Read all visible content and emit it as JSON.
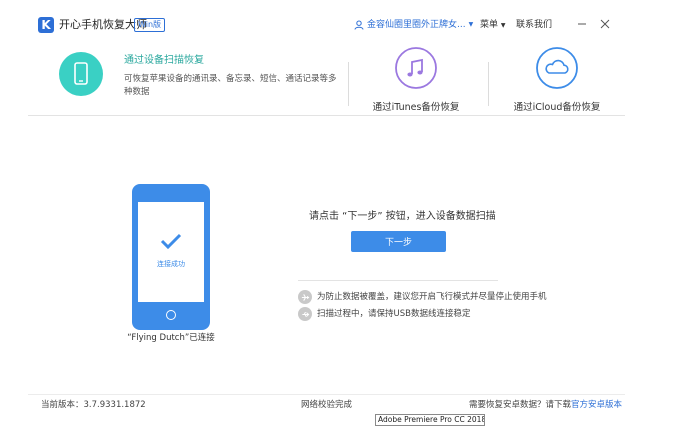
{
  "titlebar": {
    "logo_letter": "K",
    "app_title": "开心手机恢复大师",
    "edition_badge": "Win版",
    "user_name": "金容仙圈里圈外正牌女...",
    "menu_label": "菜单",
    "contact_label": "联系我们"
  },
  "modes": {
    "device": {
      "title": "通过设备扫描恢复",
      "description": "可恢复苹果设备的通讯录、备忘录、短信、通话记录等多种数据"
    },
    "itunes": {
      "label": "通过iTunes备份恢复"
    },
    "icloud": {
      "label": "通过iCloud备份恢复"
    }
  },
  "device": {
    "status": "连接成功",
    "connected_text": "“Flying Dutch”已连接"
  },
  "scan": {
    "instruction": "请点击 “下一步” 按钮，进入设备数据扫描",
    "next_button": "下一步"
  },
  "tips": [
    {
      "icon": "airplane-icon",
      "text": "为防止数据被覆盖，建议您开启飞行模式并尽量停止使用手机"
    },
    {
      "icon": "usb-icon",
      "text": "扫描过程中，请保持USB数据线连接稳定"
    }
  ],
  "footer": {
    "version": "当前版本：3.7.9331.1872",
    "network_status": "网络校验完成",
    "android_prompt": "需要恢复安卓数据？请下载",
    "android_link": "官方安卓版本"
  },
  "tooltip": "Adobe Premiere Pro CC 2018",
  "colors": {
    "accent_blue": "#3d8ce8",
    "brand_blue": "#2d6fd6",
    "device_teal": "#3ad0c4",
    "itunes_purple": "#9b78e0",
    "icloud_blue": "#3d8ce8"
  }
}
